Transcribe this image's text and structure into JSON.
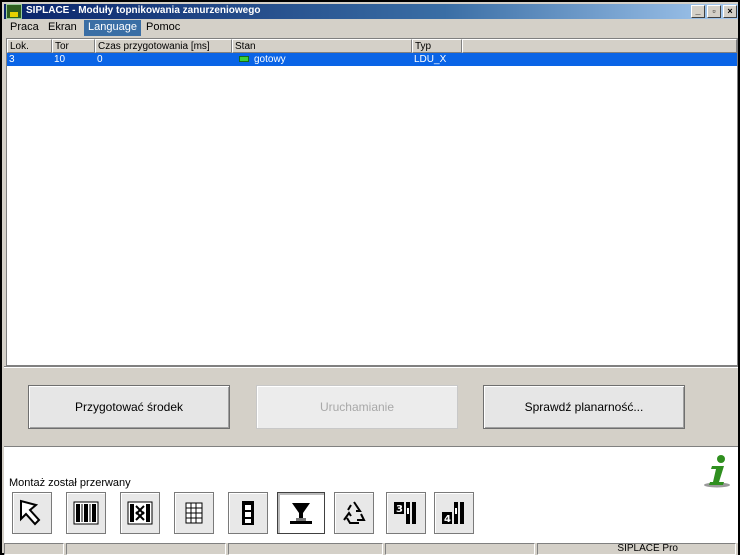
{
  "window": {
    "title": "SIPLACE - Moduły topnikowania zanurzeniowego"
  },
  "menu": [
    {
      "label": "Praca",
      "active": false
    },
    {
      "label": "Ekran",
      "active": false
    },
    {
      "label": "Language",
      "active": true
    },
    {
      "label": "Pomoc",
      "active": false
    }
  ],
  "table": {
    "columns": [
      "Lok.",
      "Tor",
      "Czas przygotowania [ms]",
      "Stan",
      "Typ"
    ],
    "rows": [
      {
        "lok": "3",
        "tor": "10",
        "czas": "0",
        "stan": "gotowy",
        "typ": "LDU_X",
        "selected": true
      }
    ]
  },
  "buttons": {
    "prepare": "Przygotować środek",
    "start": "Uruchamianie",
    "check": "Sprawdź planarność..."
  },
  "status": {
    "message": "Montaż został przerwany"
  },
  "toolbar": {
    "icons": [
      "arrow-pointer-icon",
      "feeder-rack-icon",
      "feeder-removed-icon",
      "grid-icon",
      "tape-reel-icon",
      "dip-flux-icon",
      "recycle-icon",
      "feeder-3-icon",
      "feeder-4-icon"
    ],
    "selected_index": 5
  },
  "statusbar": {
    "product": "SIPLACE Pro"
  },
  "colors": {
    "title_bar": "#0a246a",
    "selection": "#0a64e6",
    "status_ready": "#3ad13a",
    "info_icon": "#2f8f1f"
  }
}
